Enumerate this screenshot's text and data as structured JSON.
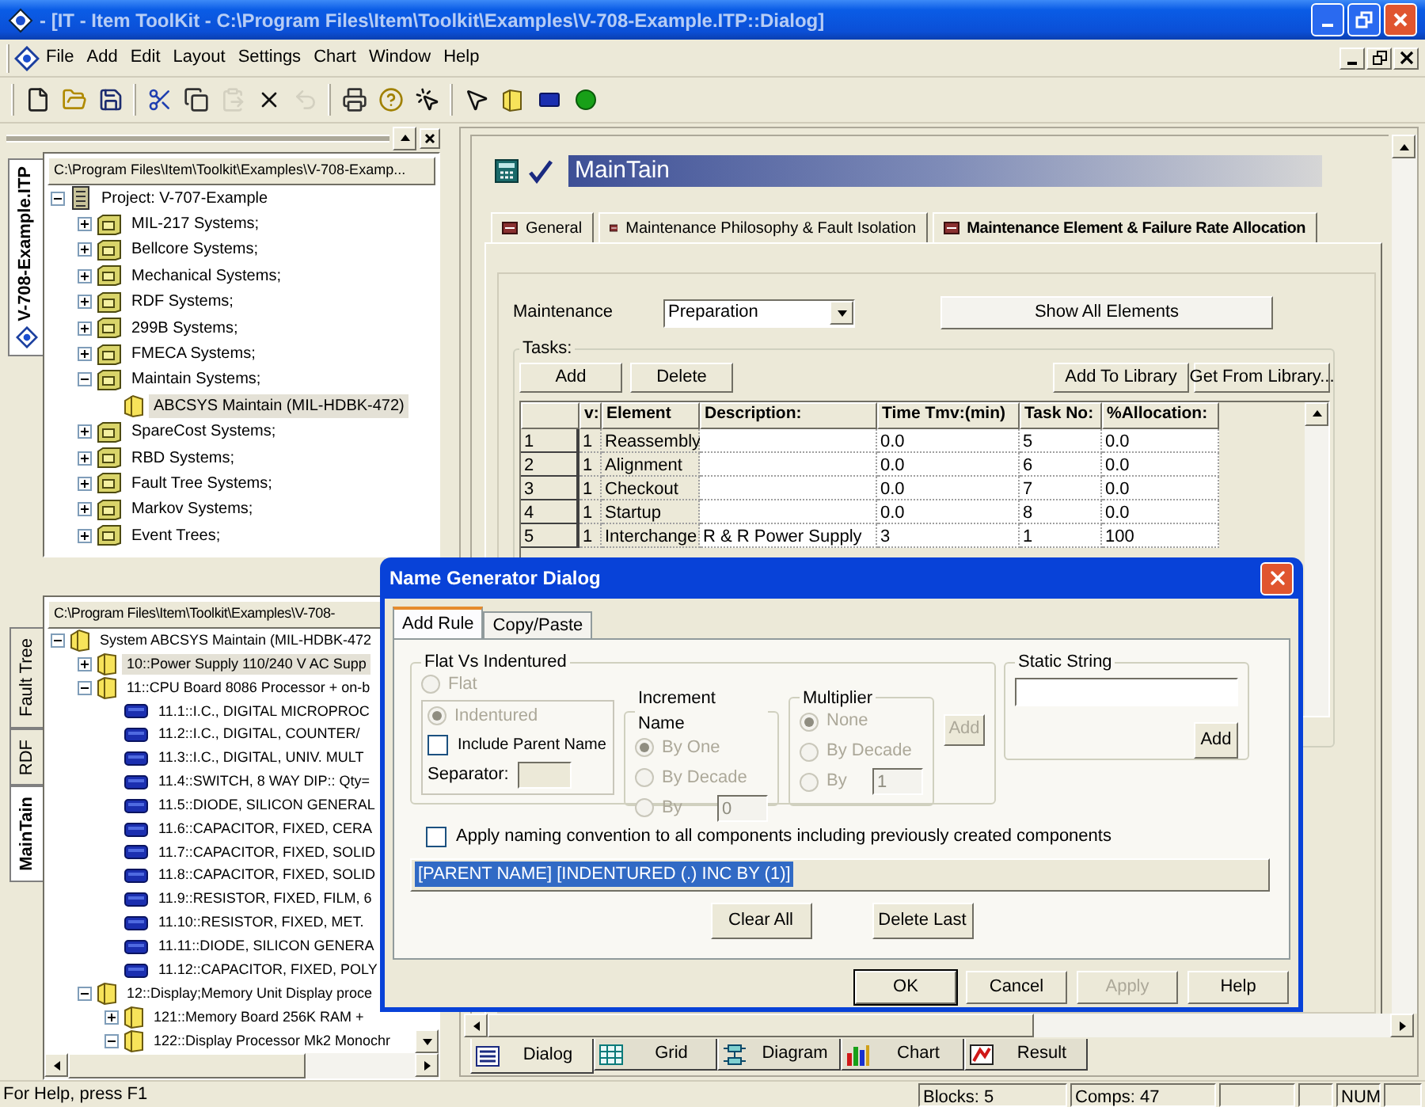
{
  "window": {
    "title": "- [IT - Item ToolKit - C:\\Program Files\\Item\\Toolkit\\Examples\\V-708-Example.ITP::Dialog]"
  },
  "menu": [
    "File",
    "Add",
    "Edit",
    "Layout",
    "Settings",
    "Chart",
    "Window",
    "Help"
  ],
  "toolbar": [
    [
      {
        "kind": "new",
        "disabled": false
      },
      {
        "kind": "open",
        "disabled": false
      },
      {
        "kind": "save",
        "disabled": false
      }
    ],
    [
      {
        "kind": "cut",
        "disabled": false
      },
      {
        "kind": "copy",
        "disabled": false
      },
      {
        "kind": "paste",
        "disabled": true
      },
      {
        "kind": "delete",
        "disabled": false
      },
      {
        "kind": "undo",
        "disabled": true
      }
    ],
    [
      {
        "kind": "print",
        "disabled": false
      },
      {
        "kind": "help",
        "disabled": false
      },
      {
        "kind": "context-help",
        "disabled": false
      }
    ],
    [
      {
        "kind": "pointer",
        "disabled": false
      },
      {
        "kind": "assembly",
        "disabled": false
      },
      {
        "kind": "part",
        "disabled": false
      },
      {
        "kind": "run",
        "disabled": false
      }
    ]
  ],
  "project_panel": {
    "tab": "V-708-Example.ITP",
    "path": "C:\\Program Files\\Item\\Toolkit\\Examples\\V-708-Examp...",
    "tree": [
      {
        "label": "Project:  V-707-Example",
        "kind": "project",
        "expanded": true,
        "selected": false,
        "children": [
          {
            "label": "MIL-217 Systems;",
            "kind": "group",
            "expanded": false,
            "selected": false
          },
          {
            "label": "Bellcore Systems;",
            "kind": "group",
            "expanded": false,
            "selected": false
          },
          {
            "label": "Mechanical Systems;",
            "kind": "group",
            "expanded": false,
            "selected": false
          },
          {
            "label": "RDF Systems;",
            "kind": "group",
            "expanded": false,
            "selected": false
          },
          {
            "label": "299B Systems;",
            "kind": "group",
            "expanded": false,
            "selected": false
          },
          {
            "label": "FMECA Systems;",
            "kind": "group",
            "expanded": false,
            "selected": false
          },
          {
            "label": "Maintain Systems;",
            "kind": "group",
            "expanded": true,
            "selected": false,
            "children": [
              {
                "label": "ABCSYS Maintain (MIL-HDBK-472)",
                "kind": "system",
                "selected": true
              }
            ]
          },
          {
            "label": "SpareCost Systems;",
            "kind": "group",
            "expanded": false,
            "selected": false
          },
          {
            "label": "RBD Systems;",
            "kind": "group",
            "expanded": false,
            "selected": false
          },
          {
            "label": "Fault Tree Systems;",
            "kind": "group",
            "expanded": false,
            "selected": false
          },
          {
            "label": "Markov Systems;",
            "kind": "group",
            "expanded": false,
            "selected": false
          },
          {
            "label": "Event Trees;",
            "kind": "group",
            "expanded": false,
            "selected": false
          }
        ]
      }
    ]
  },
  "system_panel": {
    "tabs": [
      {
        "label": "Fault Tree",
        "selected": false
      },
      {
        "label": "RDF",
        "selected": false
      },
      {
        "label": "MainTain",
        "selected": true
      }
    ],
    "path": "C:\\Program Files\\Item\\Toolkit\\Examples\\V-708-",
    "tree": [
      {
        "label": "System ABCSYS Maintain (MIL-HDBK-472",
        "kind": "system",
        "expanded": true,
        "selected": false,
        "children": [
          {
            "label": "10::Power Supply 110/240 V AC Supp",
            "kind": "assembly",
            "expanded": false,
            "selected": true
          },
          {
            "label": "11::CPU Board 8086 Processor + on-b",
            "kind": "assembly",
            "expanded": true,
            "selected": false,
            "children": [
              {
                "label": "11.1::I.C., DIGITAL MICROPROC",
                "kind": "part",
                "selected": false
              },
              {
                "label": "11.2::I.C., DIGITAL, COUNTER/",
                "kind": "part",
                "selected": false
              },
              {
                "label": "11.3::I.C., DIGITAL, UNIV. MULT",
                "kind": "part",
                "selected": false
              },
              {
                "label": "11.4::SWITCH, 8 WAY DIP:: Qty=",
                "kind": "part",
                "selected": false
              },
              {
                "label": "11.5::DIODE, SILICON GENERAL",
                "kind": "part",
                "selected": false
              },
              {
                "label": "11.6::CAPACITOR, FIXED, CERA",
                "kind": "part",
                "selected": false
              },
              {
                "label": "11.7::CAPACITOR, FIXED, SOLID",
                "kind": "part",
                "selected": false
              },
              {
                "label": "11.8::CAPACITOR, FIXED, SOLID",
                "kind": "part",
                "selected": false
              },
              {
                "label": "11.9::RESISTOR, FIXED, FILM, 6",
                "kind": "part",
                "selected": false
              },
              {
                "label": "11.10::RESISTOR, FIXED, MET.",
                "kind": "part",
                "selected": false
              },
              {
                "label": "11.11::DIODE, SILICON GENERA",
                "kind": "part",
                "selected": false
              },
              {
                "label": "11.12::CAPACITOR, FIXED, POLY",
                "kind": "part",
                "selected": false
              }
            ]
          },
          {
            "label": "12::Display;Memory Unit Display proce",
            "kind": "assembly",
            "expanded": true,
            "selected": false,
            "children": [
              {
                "label": "121::Memory Board 256K RAM +",
                "kind": "assembly",
                "expanded": false,
                "selected": false
              },
              {
                "label": "122::Display Processor Mk2 Monochr",
                "kind": "assembly",
                "expanded": true,
                "selected": false
              }
            ]
          }
        ]
      }
    ]
  },
  "main": {
    "title": "MainTain",
    "tabs": [
      {
        "label": "General",
        "selected": false
      },
      {
        "label": "Maintenance Philosophy & Fault Isolation",
        "selected": false
      },
      {
        "label": "Maintenance Element & Failure Rate Allocation",
        "selected": true
      }
    ],
    "maintenance": {
      "label": "Maintenance",
      "value": "Preparation"
    },
    "show_all_button": "Show All Elements",
    "tasks": {
      "label": "Tasks:",
      "left_buttons": [
        "Add",
        "Delete"
      ],
      "right_buttons": [
        "Add To Library",
        "Get From Library..."
      ],
      "columns": [
        "v:",
        "Element",
        "Description:",
        "Time Tmv:(min)",
        "Task No:",
        "%Allocation:"
      ],
      "rows": [
        {
          "number": "1",
          "v": "1",
          "element": "Reassembly",
          "time": "0.0",
          "task_no": "5",
          "allocation": "0.0"
        },
        {
          "number": "2",
          "v": "1",
          "element": "Alignment",
          "time": "0.0",
          "task_no": "6",
          "allocation": "0.0"
        },
        {
          "number": "3",
          "v": "1",
          "element": "Checkout",
          "time": "0.0",
          "task_no": "7",
          "allocation": "0.0"
        },
        {
          "number": "4",
          "v": "1",
          "element": "Startup",
          "time": "0.0",
          "task_no": "8",
          "allocation": "0.0"
        },
        {
          "number": "5",
          "v": "1",
          "element": "Interchange",
          "description": "R & R Power Supply",
          "time": "3",
          "task_no": "1",
          "allocation": "100"
        }
      ]
    }
  },
  "view_tabs": [
    {
      "label": "Dialog",
      "kind": "dialog",
      "selected": true
    },
    {
      "label": "Grid",
      "kind": "grid",
      "selected": false
    },
    {
      "label": "Diagram",
      "kind": "diagram",
      "selected": false
    },
    {
      "label": "Chart",
      "kind": "chart",
      "selected": false
    },
    {
      "label": "Result",
      "kind": "result",
      "selected": false
    }
  ],
  "status_bar": {
    "help": "For Help, press F1",
    "blocks": "Blocks: 5",
    "comps": "Comps: 47",
    "num": "NUM"
  },
  "dialog": {
    "title": "Name Generator Dialog",
    "tabs": [
      {
        "label": "Add Rule",
        "selected": true
      },
      {
        "label": "Copy/Paste",
        "selected": false
      }
    ],
    "flat_vs_indentured": {
      "title": "Flat Vs Indentured",
      "options": [
        {
          "label": "Flat",
          "selected": false,
          "disabled": true
        },
        {
          "label": "Indentured",
          "selected": true,
          "disabled": true
        }
      ],
      "include_parent": {
        "label": "Include Parent Name",
        "checked": false
      },
      "separator": {
        "label": "Separator:",
        "disabled": true
      }
    },
    "increment_name": {
      "title": "Increment Name",
      "options": [
        {
          "label": "By One",
          "selected": true,
          "disabled": true
        },
        {
          "label": "By Decade",
          "selected": false,
          "disabled": true
        },
        {
          "label": "By",
          "selected": false,
          "disabled": true,
          "value": "0"
        }
      ]
    },
    "multiplier": {
      "title": "Multiplier",
      "options": [
        {
          "label": "None",
          "selected": true,
          "disabled": true
        },
        {
          "label": "By Decade",
          "selected": false,
          "disabled": true
        },
        {
          "label": "By",
          "selected": false,
          "disabled": true,
          "value": "1"
        }
      ]
    },
    "rule_add_button": {
      "label": "Add",
      "disabled": true
    },
    "static_string": {
      "title": "Static String",
      "add_button": "Add"
    },
    "apply_all": {
      "label": "Apply naming convention to all components including previously created components",
      "checked": false
    },
    "rule_text": "[PARENT NAME] [INDENTURED (.) INC BY (1)]",
    "edit_buttons": [
      "Clear All",
      "Delete Last"
    ],
    "buttons": [
      {
        "label": "OK",
        "default": true,
        "disabled": false
      },
      {
        "label": "Cancel",
        "default": false,
        "disabled": false
      },
      {
        "label": "Apply",
        "default": false,
        "disabled": true
      },
      {
        "label": "Help",
        "default": false,
        "disabled": false
      }
    ]
  }
}
